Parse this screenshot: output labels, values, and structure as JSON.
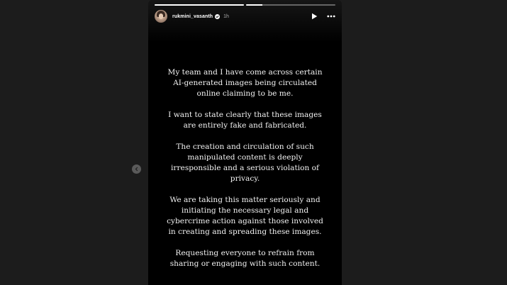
{
  "story": {
    "username": "rukmini_vasanth",
    "timestamp": "1h",
    "progress": [
      1.0,
      0.18
    ],
    "paragraphs": [
      "My team and I have come across certain AI-generated images being circulated online claiming to be me.",
      "I want to state clearly that these images are entirely fake and fabricated.",
      "The creation and circulation of such manipulated content is deeply irresponsible and a serious violation of privacy.",
      "We are taking this matter seriously and initiating the necessary legal and cybercrime action against those involved in creating and spreading these images.",
      "Requesting everyone to refrain from sharing or engaging with such content."
    ]
  },
  "icons": {
    "play": "play-icon",
    "more": "more-options-icon",
    "verified": "verified-badge-icon",
    "prev": "chevron-left-icon"
  },
  "colors": {
    "background": "#1c1c1c",
    "story": "#000000",
    "text": "#f2f2f2",
    "verified": "#3797f0"
  }
}
